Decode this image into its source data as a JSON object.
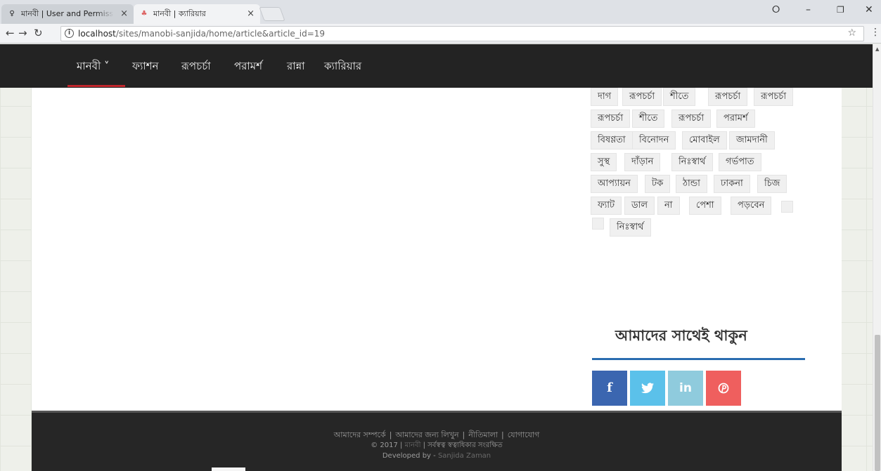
{
  "browser": {
    "tabs": [
      {
        "title": "মানবী | User and Permiss",
        "favicon": "♀",
        "active": false
      },
      {
        "title": "মানবী | ক্যারিয়ার",
        "favicon": "♣",
        "active": true
      }
    ],
    "close_glyph": "×",
    "url_host": "localhost",
    "url_path": "/sites/manobi-sanjida/home/article&article_id=19",
    "icons": [
      "back-arrow-icon",
      "forward-arrow-icon",
      "reload-icon",
      "info-icon",
      "star-icon",
      "menu-icon"
    ]
  },
  "nav": {
    "items": [
      "মানবী ˅",
      "ফ্যাশন",
      "রূপচর্চা",
      "পরামর্শ",
      "রান্না",
      "ক্যারিয়ার"
    ],
    "active_index": 0,
    "active_color": "#c0262c"
  },
  "tags": [
    "দাগ",
    "রূপচর্চা",
    "শীতে",
    "রূপচর্চা",
    "রূপচর্চা",
    "রূপচর্চা",
    "শীতে",
    "রূপচর্চা",
    "পরামর্শ",
    "বিষণ্ণতা",
    "বিনোদন",
    "মোবাইল",
    "জামদানী",
    "সুস্থ",
    "দাঁড়ান",
    "নিঃস্বার্থ",
    "গর্ভপাত",
    "আপ্যায়ন",
    "টক",
    "ঠান্ডা",
    "ঢাকনা",
    "চিজ",
    "ফ্যাট",
    "ডাল",
    "না",
    "পেশা",
    "পড়বেন",
    "",
    "",
    "নিঃস্বার্থ"
  ],
  "follow": {
    "title": "আমাদের সাথেই থাকুন",
    "rule_color": "#2a6db0",
    "social": [
      {
        "name": "facebook-icon",
        "glyph": "f",
        "color": "#3b66b0"
      },
      {
        "name": "twitter-icon",
        "glyph": "🐦",
        "color": "#5bc1ea"
      },
      {
        "name": "linkedin-icon",
        "glyph": "in",
        "color": "#8fcbdd"
      },
      {
        "name": "pinterest-icon",
        "glyph": "℗",
        "color": "#ef5f5e"
      }
    ]
  },
  "footer": {
    "links": [
      "আমাদের সম্পর্কে",
      "আমাদের জন্য লিখুন",
      "নীতিমালা",
      "যোগাযোগ"
    ],
    "link_separator": "|",
    "copyright_prefix": "© 2017 |",
    "brand": "মানবী",
    "copyright_suffix": "| সর্বস্বত্ব স্বত্বাধিকার সংরক্ষিত",
    "developed_by_label": "Developed by -",
    "developer": "Sanjida Zaman"
  }
}
